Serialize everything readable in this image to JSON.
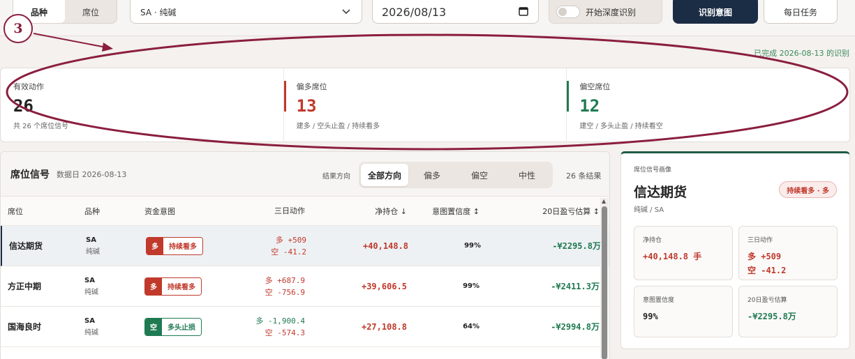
{
  "toolbar": {
    "mode_tabs": [
      "品种",
      "席位"
    ],
    "product_select": "SA · 纯碱",
    "date_value": "2026/08/13",
    "deep_toggle_label": "开始深度识别",
    "recognize_button": "识别意图",
    "daily_task_button": "每日任务"
  },
  "status": {
    "complete_text": "已完成 2026-08-13 的识别"
  },
  "stats": [
    {
      "label": "有效动作",
      "value": "26",
      "sub": "共 26 个席位信号"
    },
    {
      "label": "偏多席位",
      "value": "13",
      "sub": "建多 / 空头止盈 / 持续看多"
    },
    {
      "label": "偏空席位",
      "value": "12",
      "sub": "建空 / 多头止盈 / 持续看空"
    }
  ],
  "table": {
    "title": "席位信号",
    "date_label": "数据日 2026-08-13",
    "filter_label": "结果方向",
    "filters": [
      "全部方向",
      "偏多",
      "偏空",
      "中性"
    ],
    "result_count": "26 条结果",
    "columns": [
      "席位",
      "品种",
      "资金意图",
      "三日动作",
      "净持仓 ↓",
      "意图置信度 ↕",
      "20日盈亏估算 ↕"
    ],
    "rows": [
      {
        "seat": "信达期货",
        "code": "SA",
        "name": "纯碱",
        "tag_key": "多",
        "tag_text": "持续看多",
        "act_long": "多 +509",
        "act_short": "空 -41.2",
        "net": "+40,148.8",
        "conf": "99%",
        "pnl": "-¥2295.8万"
      },
      {
        "seat": "方正中期",
        "code": "SA",
        "name": "纯碱",
        "tag_key": "多",
        "tag_text": "持续看多",
        "act_long": "多 +687.9",
        "act_short": "空 -756.9",
        "net": "+39,606.5",
        "conf": "99%",
        "pnl": "-¥2411.3万"
      },
      {
        "seat": "国海良时",
        "code": "SA",
        "name": "纯碱",
        "tag_key": "空",
        "tag_text": "多头止损",
        "act_long": "多 -1,900.4",
        "act_short": "空 -574.3",
        "net": "+27,108.8",
        "conf": "64%",
        "pnl": "-¥2994.8万"
      }
    ]
  },
  "profile": {
    "kicker": "席位信号画像",
    "name": "信达期货",
    "meta": "纯碱 / SA",
    "badge": "持续看多 · 多",
    "net_label": "净持仓",
    "net_value": "+40,148.8 手",
    "act_label": "三日动作",
    "act_long": "多 +509",
    "act_short": "空 -41.2",
    "conf_label": "意图置信度",
    "conf_value": "99%",
    "pnl_label": "20日盈亏估算",
    "pnl_value": "-¥2295.8万"
  },
  "annotation": {
    "marker_number": "3"
  },
  "colors": {
    "long": "#c0392b",
    "short": "#1f7a52",
    "primary": "#1b2c45",
    "annotation": "#8b1e3f"
  }
}
